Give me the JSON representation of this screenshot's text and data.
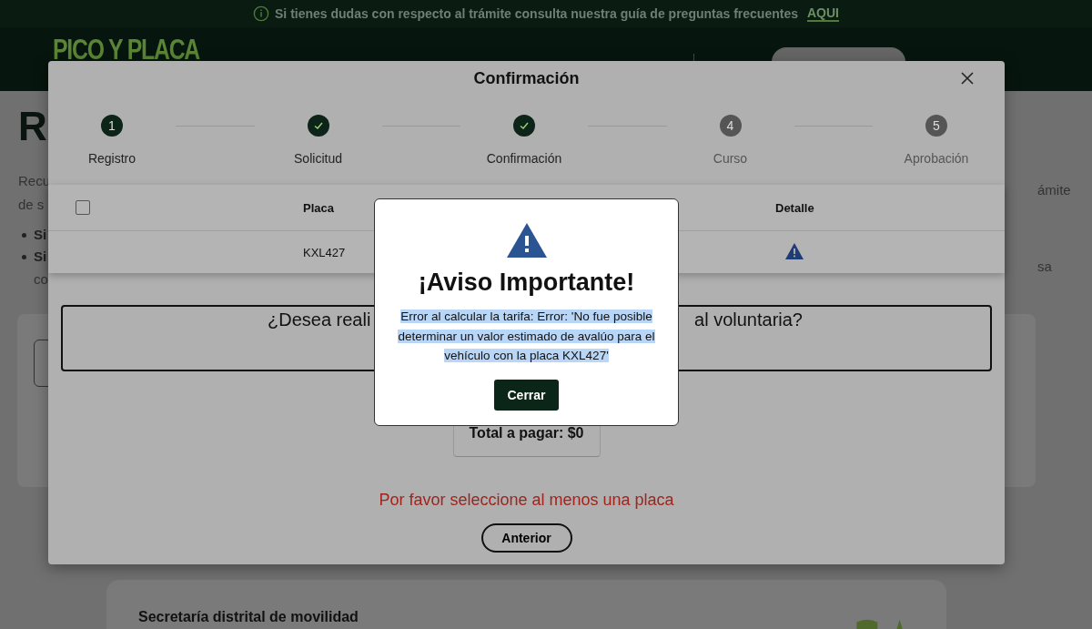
{
  "banner": {
    "text": "Si tienes dudas con respecto al trámite consulta nuestra guía de preguntas frecuentes",
    "link": "AQUI"
  },
  "header": {
    "logo": "PICO Y PLACA"
  },
  "page": {
    "heading": "R",
    "left_lines": [
      "Recu",
      "de s"
    ],
    "bullets": [
      "Si",
      "Si"
    ],
    "bullet_continuation": "co",
    "right_lines": [
      "ámite",
      "sa"
    ],
    "footer_title": "Secretaría distrital de movilidad"
  },
  "modal": {
    "title": "Confirmación",
    "steps": [
      {
        "label": "Registro",
        "completed": false,
        "reached": true,
        "number": "1"
      },
      {
        "label": "Solicitud",
        "completed": true,
        "reached": true
      },
      {
        "label": "Confirmación",
        "completed": true,
        "reached": true
      },
      {
        "label": "Curso",
        "completed": false,
        "reached": false,
        "number": "4"
      },
      {
        "label": "Aprobación",
        "completed": false,
        "reached": false,
        "number": "5"
      }
    ],
    "table": {
      "select_all": {
        "checked": false
      },
      "columns": [
        "Placa",
        "Detalle"
      ],
      "rows": [
        {
          "placa": "KXL427",
          "warning": true
        }
      ]
    },
    "question_left": "¿Desea reali",
    "question_right": "al voluntaria?",
    "total": "Total a pagar: $0",
    "error": "Por favor seleccione al menos una placa",
    "back_button": "Anterior"
  },
  "alert": {
    "title": "¡Aviso Importante!",
    "message": "Error al calcular la tarifa: Error: 'No fue posible determinar un valor estimado de avalúo para el vehículo con la placa KXL427'",
    "text_selected": true,
    "button": "Cerrar"
  }
}
